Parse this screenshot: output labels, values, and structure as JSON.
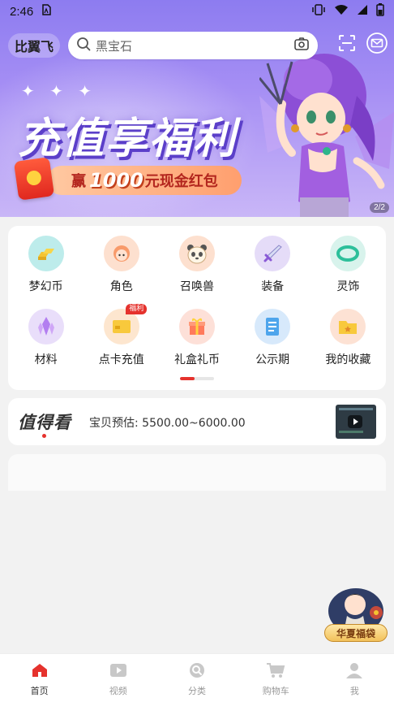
{
  "status_bar": {
    "time": "2:46"
  },
  "header": {
    "brand": "比翼飞",
    "search_placeholder": "黑宝石"
  },
  "banner": {
    "headline": "充值享福利",
    "win_label": "赢",
    "amount": "1000",
    "reward_text": "元现金红包",
    "pager": "2/2",
    "colors": {
      "top": "#8d7cf0",
      "bottom": "#c9b6f7",
      "pill": "#ff9f6e"
    }
  },
  "categories": [
    {
      "label": "梦幻币",
      "icon": "gold-bars-icon",
      "color": "#bdeceb"
    },
    {
      "label": "角色",
      "icon": "character-icon",
      "color": "#fde0cf"
    },
    {
      "label": "召唤兽",
      "icon": "panda-icon",
      "color": "#fde0cf"
    },
    {
      "label": "装备",
      "icon": "sword-icon",
      "color": "#e5dcf8"
    },
    {
      "label": "灵饰",
      "icon": "jade-ring-icon",
      "color": "#d8f3ec"
    },
    {
      "label": "材料",
      "icon": "crystal-icon",
      "color": "#e9defa"
    },
    {
      "label": "点卡充值",
      "icon": "point-card-icon",
      "color": "#fde6cf",
      "tag": "福利"
    },
    {
      "label": "礼盒礼币",
      "icon": "gift-box-icon",
      "color": "#fde0d8"
    },
    {
      "label": "公示期",
      "icon": "notice-list-icon",
      "color": "#d7e9fb"
    },
    {
      "label": "我的收藏",
      "icon": "favorite-star-icon",
      "color": "#fde2d4"
    }
  ],
  "worth_look": {
    "title": "值得看",
    "estimate": "宝贝预估: 5500.00~6000.00"
  },
  "promo": {
    "label": "华夏福袋"
  },
  "bottom_nav": [
    {
      "label": "首页",
      "icon": "home-icon",
      "active": true
    },
    {
      "label": "视频",
      "icon": "video-icon",
      "active": false
    },
    {
      "label": "分类",
      "icon": "category-icon",
      "active": false
    },
    {
      "label": "购物车",
      "icon": "cart-icon",
      "active": false
    },
    {
      "label": "我",
      "icon": "profile-icon",
      "active": false
    }
  ],
  "accent_color": "#e5322d"
}
